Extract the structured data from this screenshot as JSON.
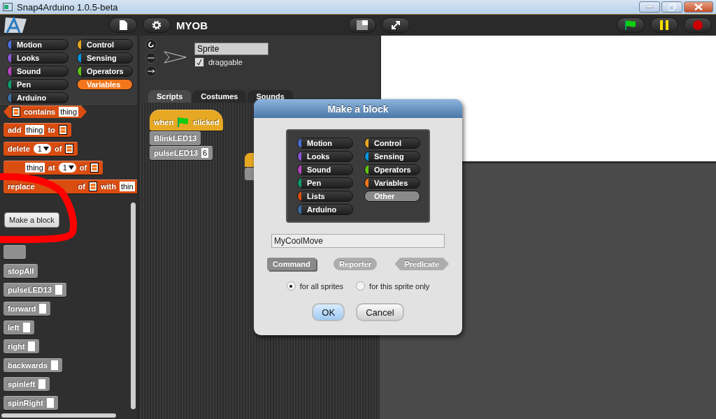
{
  "window": {
    "title": "Snap4Arduino 1.0.5-beta"
  },
  "toolbar": {
    "project_name": "MYOB"
  },
  "categories": [
    {
      "label": "Motion",
      "color": "#4a6cd4",
      "selected": false
    },
    {
      "label": "Looks",
      "color": "#8a55d7",
      "selected": false
    },
    {
      "label": "Sound",
      "color": "#bb42c3",
      "selected": false
    },
    {
      "label": "Pen",
      "color": "#0e9a6c",
      "selected": false
    },
    {
      "label": "Arduino",
      "color": "#3b6ea5",
      "selected": false
    },
    {
      "label": "Control",
      "color": "#e6a822",
      "selected": false
    },
    {
      "label": "Sensing",
      "color": "#0494dc",
      "selected": false
    },
    {
      "label": "Operators",
      "color": "#62c213",
      "selected": false
    },
    {
      "label": "Variables",
      "color": "#f3761d",
      "selected": true
    }
  ],
  "palette": [
    {
      "kind": "predicate",
      "color": "#d94d11",
      "parts": [
        {
          "kind": "list-icon"
        },
        {
          "kind": "text",
          "text": "contains"
        },
        {
          "kind": "slot",
          "text": "thing"
        }
      ]
    },
    {
      "kind": "command",
      "color": "#d94d11",
      "parts": [
        {
          "kind": "text",
          "text": "add"
        },
        {
          "kind": "slot",
          "text": "thing"
        },
        {
          "kind": "text",
          "text": "to"
        },
        {
          "kind": "list-icon"
        }
      ]
    },
    {
      "kind": "command",
      "color": "#d94d11",
      "parts": [
        {
          "kind": "text",
          "text": "delete"
        },
        {
          "kind": "dropdown",
          "text": "1"
        },
        {
          "kind": "text",
          "text": "of"
        },
        {
          "kind": "list-icon"
        }
      ]
    },
    {
      "kind": "command",
      "color": "#d94d11",
      "parts": [
        {
          "kind": "gap"
        },
        {
          "kind": "slot",
          "text": "thing"
        },
        {
          "kind": "text",
          "text": "at"
        },
        {
          "kind": "dropdown",
          "text": "1"
        },
        {
          "kind": "text",
          "text": "of"
        },
        {
          "kind": "list-icon"
        }
      ]
    },
    {
      "kind": "command",
      "color": "#d94d11",
      "parts": [
        {
          "kind": "text",
          "text": "replace"
        },
        {
          "kind": "wide-gap"
        },
        {
          "kind": "text",
          "text": "of"
        },
        {
          "kind": "list-icon"
        },
        {
          "kind": "text",
          "text": "with"
        },
        {
          "kind": "slot",
          "text": "thin"
        }
      ]
    },
    {
      "kind": "button",
      "label": "Make a block"
    },
    {
      "kind": "command",
      "color": "#8f8f8f",
      "parts": [
        {
          "kind": "gap"
        }
      ]
    },
    {
      "kind": "command",
      "color": "#8f8f8f",
      "parts": [
        {
          "kind": "text",
          "text": "stopAll"
        }
      ]
    },
    {
      "kind": "command",
      "color": "#8f8f8f",
      "parts": [
        {
          "kind": "text",
          "text": "pulseLED13"
        },
        {
          "kind": "empty-slot"
        }
      ]
    },
    {
      "kind": "command",
      "color": "#8f8f8f",
      "parts": [
        {
          "kind": "text",
          "text": "forward"
        },
        {
          "kind": "empty-slot"
        }
      ]
    },
    {
      "kind": "command",
      "color": "#8f8f8f",
      "parts": [
        {
          "kind": "text",
          "text": "left"
        },
        {
          "kind": "empty-slot"
        }
      ]
    },
    {
      "kind": "command",
      "color": "#8f8f8f",
      "parts": [
        {
          "kind": "text",
          "text": "right"
        },
        {
          "kind": "empty-slot"
        }
      ]
    },
    {
      "kind": "command",
      "color": "#8f8f8f",
      "parts": [
        {
          "kind": "text",
          "text": "backwards"
        },
        {
          "kind": "empty-slot"
        }
      ]
    },
    {
      "kind": "command",
      "color": "#8f8f8f",
      "parts": [
        {
          "kind": "text",
          "text": "spinleft"
        },
        {
          "kind": "empty-slot"
        }
      ]
    },
    {
      "kind": "command",
      "color": "#8f8f8f",
      "parts": [
        {
          "kind": "text",
          "text": "spinRight"
        },
        {
          "kind": "empty-slot"
        }
      ]
    }
  ],
  "sprite": {
    "name": "Sprite",
    "draggable": {
      "label": "draggable",
      "checked": true
    }
  },
  "tabs": [
    {
      "label": "Scripts",
      "selected": true
    },
    {
      "label": "Costumes",
      "selected": false
    },
    {
      "label": "Sounds",
      "selected": false
    }
  ],
  "scripts": [
    {
      "kind": "hat",
      "color": "#e6a822",
      "parts": [
        {
          "kind": "text",
          "text": "when"
        },
        {
          "kind": "flag-icon"
        },
        {
          "kind": "text",
          "text": "clicked"
        }
      ]
    },
    {
      "kind": "command",
      "color": "#8f8f8f",
      "parts": [
        {
          "kind": "text",
          "text": "BlinkLED13"
        }
      ]
    },
    {
      "kind": "command",
      "color": "#8f8f8f",
      "parts": [
        {
          "kind": "text",
          "text": "pulseLED13"
        },
        {
          "kind": "slot",
          "text": "6"
        }
      ]
    }
  ],
  "dialog": {
    "title": "Make a block",
    "categories": [
      {
        "label": "Motion",
        "color": "#4a6cd4",
        "selected": false
      },
      {
        "label": "Looks",
        "color": "#8a55d7",
        "selected": false
      },
      {
        "label": "Sound",
        "color": "#bb42c3",
        "selected": false
      },
      {
        "label": "Pen",
        "color": "#0e9a6c",
        "selected": false
      },
      {
        "label": "Lists",
        "color": "#d94d11",
        "selected": false
      },
      {
        "label": "Arduino",
        "color": "#3b6ea5",
        "selected": false
      },
      {
        "label": "Control",
        "color": "#e6a822",
        "selected": false
      },
      {
        "label": "Sensing",
        "color": "#0494dc",
        "selected": false
      },
      {
        "label": "Operators",
        "color": "#62c213",
        "selected": false
      },
      {
        "label": "Variables",
        "color": "#f3761d",
        "selected": false
      },
      {
        "label": "Other",
        "color": "#8a8a8a",
        "selected": true
      }
    ],
    "name_field": {
      "value": "MyCoolMove"
    },
    "block_types": [
      {
        "label": "Command",
        "kind": "command",
        "selected": true
      },
      {
        "label": "Reporter",
        "kind": "reporter",
        "selected": false
      },
      {
        "label": "Predicate",
        "kind": "predicate",
        "selected": false
      }
    ],
    "scope": [
      {
        "label": "for all sprites",
        "selected": true
      },
      {
        "label": "for this sprite only",
        "selected": false
      }
    ],
    "buttons": [
      {
        "label": "OK",
        "default": true
      },
      {
        "label": "Cancel",
        "default": false
      }
    ]
  }
}
